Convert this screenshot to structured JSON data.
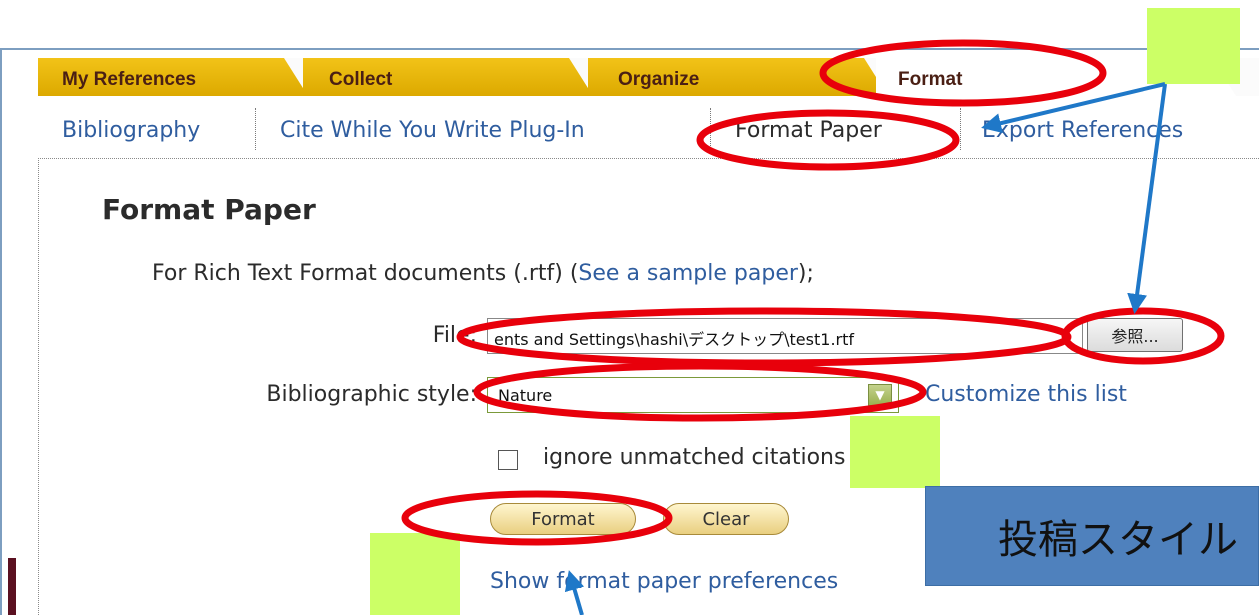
{
  "tabs": [
    {
      "label": "My References",
      "state": "inactive"
    },
    {
      "label": "Collect",
      "state": "inactive"
    },
    {
      "label": "Organize",
      "state": "inactive"
    },
    {
      "label": "Format",
      "state": "active"
    }
  ],
  "subnav": [
    {
      "label": "Bibliography"
    },
    {
      "label": "Cite While You Write Plug-In"
    },
    {
      "label": "Format Paper",
      "active": true
    },
    {
      "label": "Export References"
    }
  ],
  "page": {
    "heading": "Format Paper",
    "intro_prefix": "For Rich Text Format documents (.rtf) (",
    "intro_link": "See a sample paper",
    "intro_suffix": ");"
  },
  "form": {
    "file_label": "File:",
    "file_value": "ents and Settings\\hashi\\デスクトップ\\test1.rtf",
    "browse_label": "参照...",
    "style_label": "Bibliographic style:",
    "style_value": "Nature",
    "customize_link": "Customize this list",
    "ignore_label": "ignore unmatched citations",
    "ignore_checked": false,
    "format_button": "Format",
    "clear_button": "Clear",
    "preferences_link": "Show format paper preferences"
  },
  "annotation": {
    "style_callout": "投稿スタイル"
  },
  "colors": {
    "tab_yellow": "#e8b70f",
    "tab_text": "#4a1f14",
    "link_blue": "#2f5d9f",
    "highlight_red": "#e8000b",
    "arrow_blue": "#1f78c8",
    "marker_green": "#ccff66",
    "callout_blue": "#4f81bd"
  }
}
